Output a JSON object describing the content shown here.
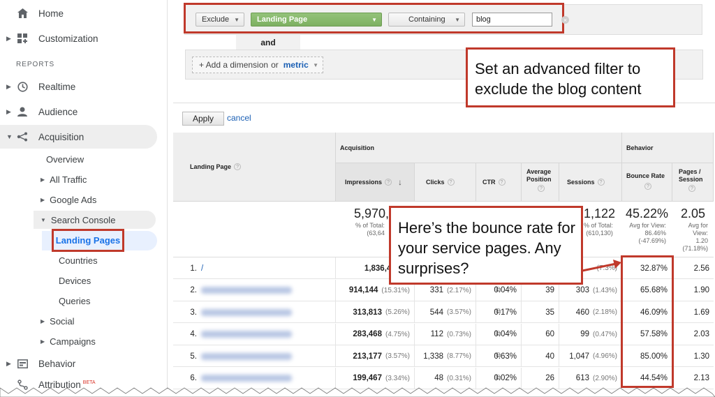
{
  "sidebar": {
    "home": "Home",
    "customization": "Customization",
    "reports_label": "REPORTS",
    "realtime": "Realtime",
    "audience": "Audience",
    "acquisition": "Acquisition",
    "overview": "Overview",
    "all_traffic": "All Traffic",
    "google_ads": "Google Ads",
    "search_console": "Search Console",
    "landing_pages": "Landing Pages",
    "countries": "Countries",
    "devices": "Devices",
    "queries": "Queries",
    "social": "Social",
    "campaigns": "Campaigns",
    "behavior": "Behavior",
    "attribution": "Attribution",
    "beta": "BETA"
  },
  "filter": {
    "mode": "Exclude",
    "dimension": "Landing Page",
    "match": "Containing",
    "value": "blog",
    "and_label": "and",
    "add_dimension_prefix": "+ Add a dimension",
    "add_or": "or",
    "add_metric": "metric",
    "apply": "Apply",
    "cancel": "cancel"
  },
  "callouts": {
    "filter_note": "Set an advanced filter to exclude the blog content",
    "bounce_note": "Here’s the bounce rate for your service pages. Any surprises?"
  },
  "table": {
    "group_acquisition": "Acquisition",
    "group_behavior": "Behavior",
    "col_landing_page": "Landing Page",
    "col_impressions": "Impressions",
    "col_clicks": "Clicks",
    "col_ctr": "CTR",
    "col_avg_position": "Average Position",
    "col_sessions": "Sessions",
    "col_bounce_rate": "Bounce Rate",
    "col_pages_session": "Pages / Session",
    "totals": {
      "impressions": "5,970,",
      "impressions_sub": "% of Total:",
      "impressions_sub2": "(63,64",
      "sessions": "1,122",
      "sessions_sub": "% of Total:",
      "sessions_sub2": "(610,130)",
      "bounce_rate": "45.22%",
      "bounce_sub1": "Avg for View:",
      "bounce_sub2": "86.46%",
      "bounce_sub3": "(-47.69%)",
      "pages_session": "2.05",
      "pages_sub1": "Avg for",
      "pages_sub2": "View:",
      "pages_sub3": "1.20",
      "pages_sub4": "(71.18%)"
    },
    "rows": [
      {
        "idx": "1.",
        "page": "/",
        "impressions": "1,836,400",
        "imp_pct": "(3",
        "clicks": "",
        "clicks_pct": "",
        "ctr": "",
        "position": "",
        "sessions": "",
        "sessions_pct": "(7.3%)",
        "bounce": "32.87%",
        "pps": "2.56"
      },
      {
        "idx": "2.",
        "page": "",
        "impressions": "914,144",
        "imp_pct": "(15.31%)",
        "clicks": "331",
        "clicks_pct": "(2.17%)",
        "ctr": "0.04%",
        "position": "39",
        "sessions": "303",
        "sessions_pct": "(1.43%)",
        "bounce": "65.68%",
        "pps": "1.90"
      },
      {
        "idx": "3.",
        "page": "",
        "impressions": "313,813",
        "imp_pct": "(5.26%)",
        "clicks": "544",
        "clicks_pct": "(3.57%)",
        "ctr": "0.17%",
        "position": "35",
        "sessions": "460",
        "sessions_pct": "(2.18%)",
        "bounce": "46.09%",
        "pps": "1.69"
      },
      {
        "idx": "4.",
        "page": "",
        "impressions": "283,468",
        "imp_pct": "(4.75%)",
        "clicks": "112",
        "clicks_pct": "(0.73%)",
        "ctr": "0.04%",
        "position": "60",
        "sessions": "99",
        "sessions_pct": "(0.47%)",
        "bounce": "57.58%",
        "pps": "2.03"
      },
      {
        "idx": "5.",
        "page": "",
        "impressions": "213,177",
        "imp_pct": "(3.57%)",
        "clicks": "1,338",
        "clicks_pct": "(8.77%)",
        "ctr": "0.63%",
        "position": "40",
        "sessions": "1,047",
        "sessions_pct": "(4.96%)",
        "bounce": "85.00%",
        "pps": "1.30"
      },
      {
        "idx": "6.",
        "page": "",
        "impressions": "199,467",
        "imp_pct": "(3.34%)",
        "clicks": "48",
        "clicks_pct": "(0.31%)",
        "ctr": "0.02%",
        "position": "26",
        "sessions": "613",
        "sessions_pct": "(2.90%)",
        "bounce": "44.54%",
        "pps": "2.13"
      }
    ]
  },
  "colors": {
    "highlight": "#c0392b",
    "link": "#1a5fb4",
    "green_button": "#7db061"
  }
}
